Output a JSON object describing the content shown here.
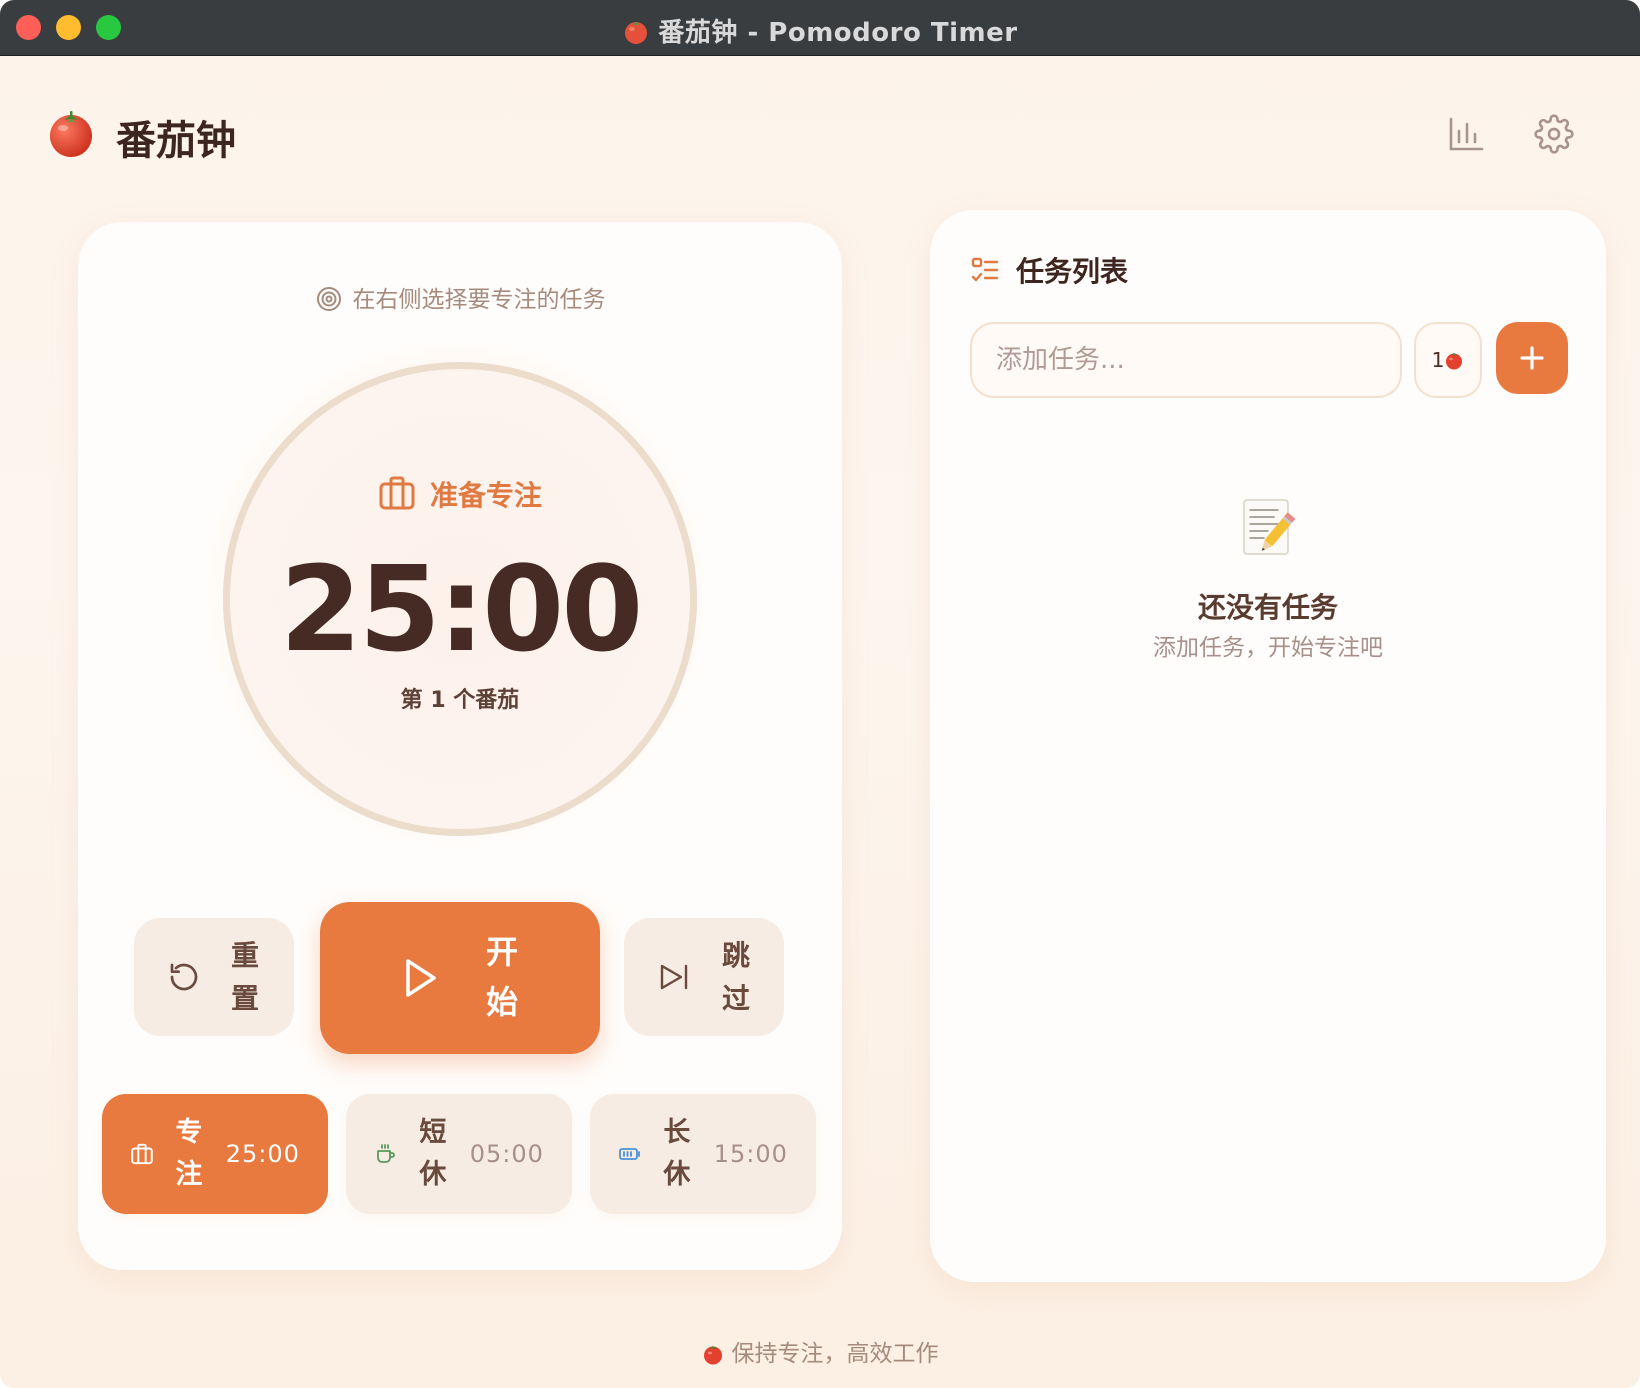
{
  "window": {
    "title": "番茄钟 - Pomodoro Timer"
  },
  "header": {
    "app_title": "番茄钟",
    "stats_icon": "bar-chart-icon",
    "settings_icon": "gear-icon"
  },
  "timer": {
    "focus_hint": "在右侧选择要专注的任务",
    "status": "准备专注",
    "time": "25:00",
    "round": "第 1 个番茄",
    "controls": {
      "reset_label": "重置",
      "start_label": "开始",
      "skip_label": "跳过"
    },
    "modes": [
      {
        "label": "专注",
        "time": "25:00",
        "active": true
      },
      {
        "label": "短休",
        "time": "05:00",
        "active": false
      },
      {
        "label": "长休",
        "time": "15:00",
        "active": false
      }
    ]
  },
  "tasks": {
    "title": "任务列表",
    "input_placeholder": "添加任务...",
    "input_value": "",
    "pomodoro_count": "1",
    "add_icon": "plus-icon",
    "empty_title": "还没有任务",
    "empty_subtitle": "添加任务，开始专注吧"
  },
  "footer": {
    "text": "保持专注，高效工作"
  },
  "colors": {
    "accent": "#e8793f",
    "text_dark": "#452b23",
    "muted": "#a58b7d",
    "card_bg": "#fffdfb",
    "button_bg": "#f6ece4"
  }
}
